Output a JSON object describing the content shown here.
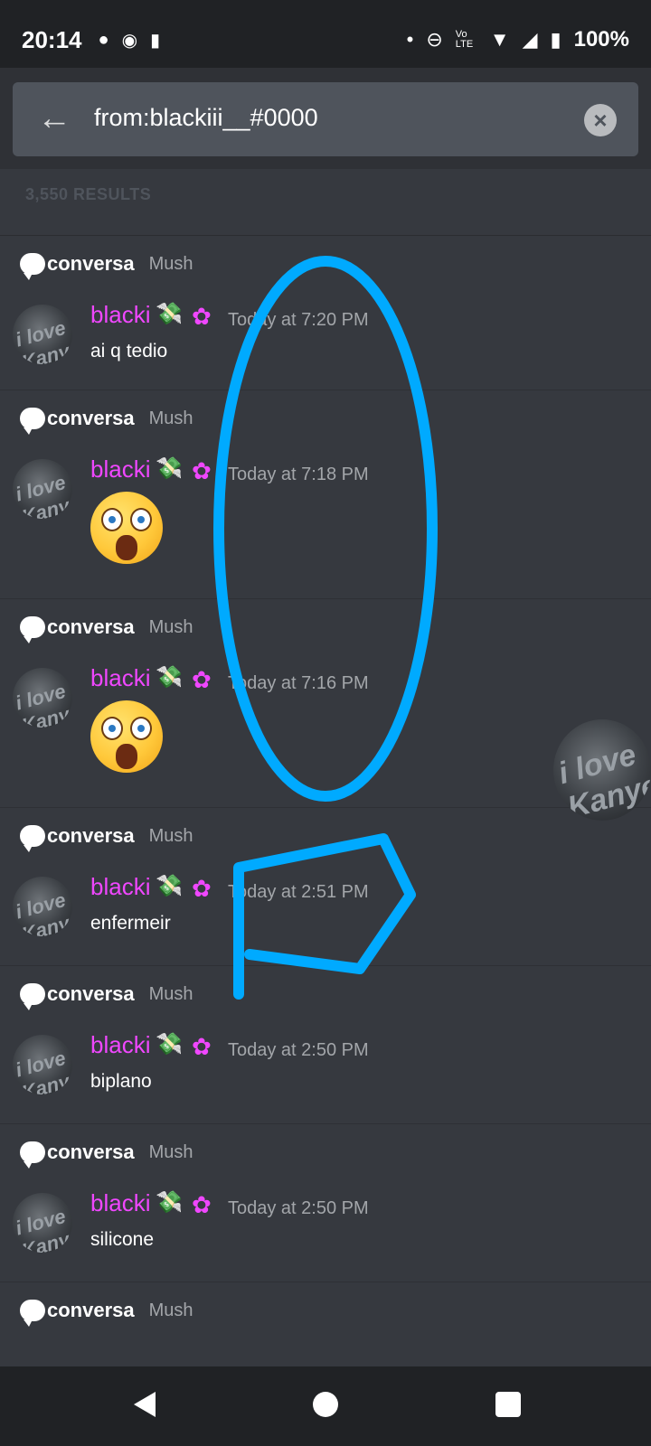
{
  "status_bar": {
    "time": "20:14",
    "battery_percent": "100%",
    "volte_label": "Vo LTE"
  },
  "search": {
    "query": "from:blackiii__#0000",
    "results_count": "3,550 RESULTS"
  },
  "results": [
    {
      "channel": "conversa",
      "server": "Mush",
      "username": "blacki",
      "timestamp": "Today at 7:20 PM",
      "content": "ai q tedio",
      "type": "text"
    },
    {
      "channel": "conversa",
      "server": "Mush",
      "username": "blacki",
      "timestamp": "Today at 7:18 PM",
      "content": "",
      "type": "emoji"
    },
    {
      "channel": "conversa",
      "server": "Mush",
      "username": "blacki",
      "timestamp": "Today at 7:16 PM",
      "content": "",
      "type": "emoji"
    },
    {
      "channel": "conversa",
      "server": "Mush",
      "username": "blacki",
      "timestamp": "Today at 2:51 PM",
      "content": "enfermeir",
      "type": "text"
    },
    {
      "channel": "conversa",
      "server": "Mush",
      "username": "blacki",
      "timestamp": "Today at 2:50 PM",
      "content": "biplano",
      "type": "text"
    },
    {
      "channel": "conversa",
      "server": "Mush",
      "username": "blacki",
      "timestamp": "Today at 2:50 PM",
      "content": "silicone",
      "type": "text"
    },
    {
      "channel": "conversa",
      "server": "Mush",
      "username": "",
      "timestamp": "",
      "content": "",
      "type": "partial"
    }
  ],
  "colors": {
    "background": "#36393f",
    "username": "#f047ff",
    "annotation_stroke": "#00aaff"
  },
  "icons": {
    "back": "arrow-left-icon",
    "clear": "close-circle-icon",
    "channel": "speech-bubble-icon",
    "badge": "flower-badge-icon",
    "money": "money-with-wings-icon"
  },
  "avatar_text": "i love Kanye"
}
